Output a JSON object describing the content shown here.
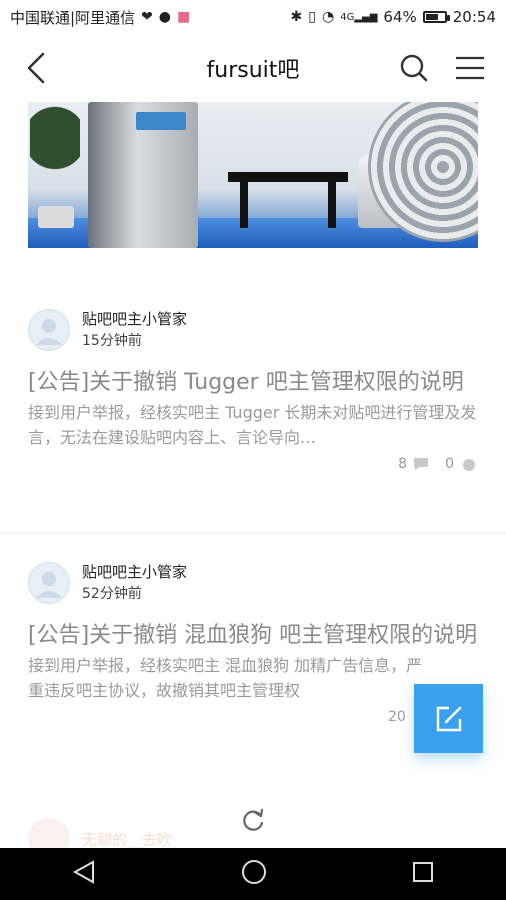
{
  "status_bar": {
    "carrier": "中国联通|阿里通信",
    "network": "4G",
    "battery": "64%",
    "time": "20:54",
    "icons": [
      "heart-monitor-icon",
      "wechat-icon",
      "notification-icon",
      "bluetooth-icon",
      "vibrate-icon",
      "wifi-icon",
      "signal-icon",
      "battery-icon"
    ]
  },
  "header": {
    "title": "fursuit吧",
    "icons": [
      "back-icon",
      "search-icon",
      "menu-icon"
    ]
  },
  "posts": [
    {
      "author": "贴吧吧主小管家",
      "time": "15分钟前",
      "title": "[公告]关于撤销 Tugger 吧主管理权限的说明",
      "excerpt": "接到用户举报，经核实吧主 Tugger 长期未对贴吧进行管理及发言，无法在建设贴吧内容上、言论导向…",
      "comments": "8",
      "likes": "0"
    },
    {
      "author": "贴吧吧主小管家",
      "time": "52分钟前",
      "title": "[公告]关于撤销 混血狼狗   吧主管理权限的说明",
      "excerpt": "接到用户举报，经核实吧主 混血狼狗 加精广告信息，严重违反吧主协议，故撤销其吧主管理权",
      "comments": "20",
      "likes": ""
    }
  ],
  "faded_item": {
    "author": "无聊的__去吹"
  },
  "fab": {
    "icon": "edit-icon"
  },
  "refresh": {
    "icon": "refresh-icon"
  },
  "nav": {
    "icons": [
      "nav-back-icon",
      "nav-home-icon",
      "nav-recents-icon"
    ]
  },
  "colors": {
    "accent": "#3aa0f0",
    "title_gray": "#8a8a8a"
  }
}
